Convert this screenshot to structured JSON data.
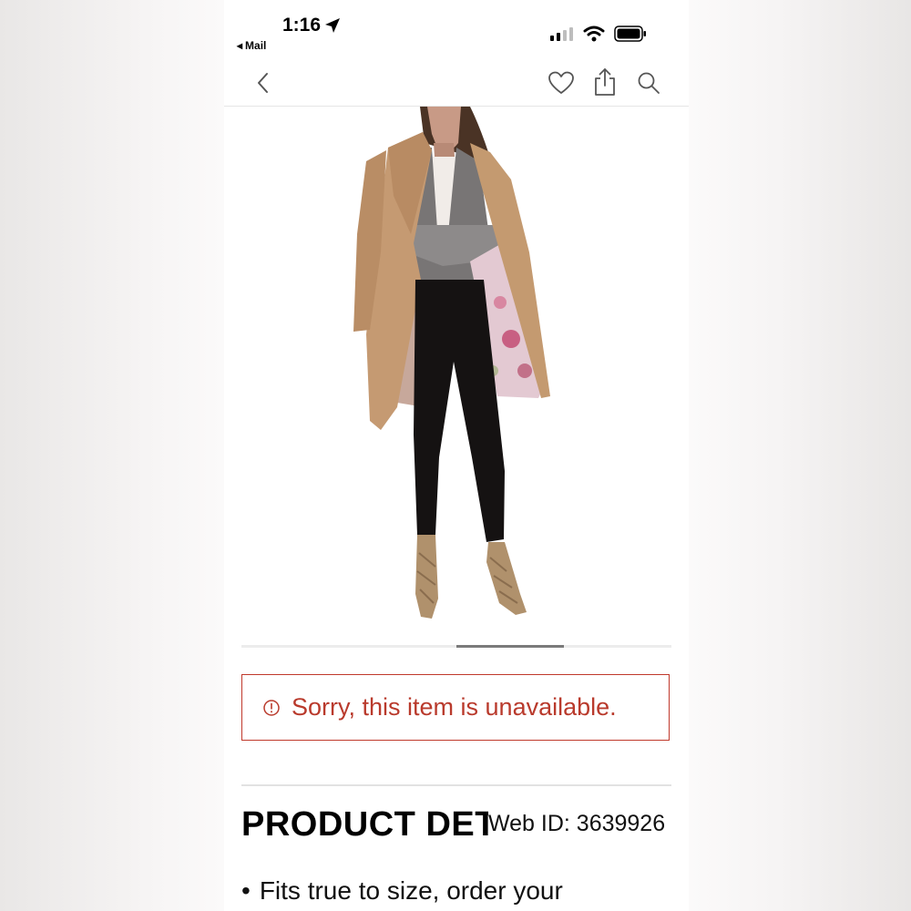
{
  "status_bar": {
    "time": "1:16",
    "back_app": "Mail"
  },
  "navbar": {
    "icons": [
      "chevron-left-icon",
      "heart-icon",
      "share-icon",
      "search-icon"
    ]
  },
  "carousel": {
    "current_index": 3,
    "total": 4
  },
  "alert": {
    "icon": "exclamation-circle-icon",
    "message": "Sorry, this item is unavailable.",
    "color": "#b93a2c"
  },
  "product_details": {
    "title": "PRODUCT DETAILS",
    "web_id": "Web ID: 3639926",
    "bullet": "Fits true to size, order your"
  }
}
